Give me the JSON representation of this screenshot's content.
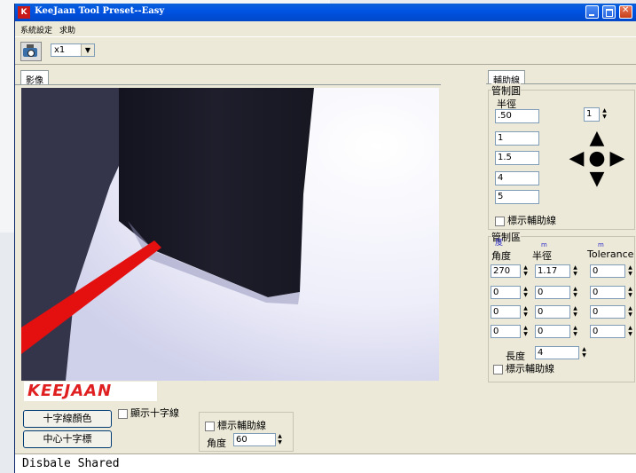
{
  "window": {
    "title": "KeeJaan Tool Preset--Easy",
    "app_icon_text": "K"
  },
  "menu": {
    "items": [
      "系統設定",
      "求助"
    ]
  },
  "toolbar": {
    "zoom_value": "x1"
  },
  "left_tab": {
    "label": "影像"
  },
  "logo": {
    "text": "KEEJAAN"
  },
  "bottom": {
    "crosshair_color_button": "十字線顏色",
    "center_crosshair_button": "中心十字標",
    "show_crosshair_label": "顯示十字線",
    "show_guides_label": "標示輔助線",
    "angle_label": "角度",
    "angle_value": "60"
  },
  "right_tab": {
    "label": "輔助線"
  },
  "control_circle": {
    "title": "管制圓",
    "radius_label": "半徑",
    "radii": [
      ".50",
      "1",
      "1.5",
      "4",
      "5"
    ],
    "spinner_value": "1",
    "show_guides_label": "標示輔助線"
  },
  "control_area": {
    "title": "管制區",
    "unit_angle": "度",
    "unit_radius": "m",
    "unit_tolerance": "m",
    "angle_header": "角度",
    "radius_header": "半徑",
    "tolerance_header": "Tolerance",
    "rows": [
      {
        "angle": "270",
        "radius": "1.17",
        "tolerance": "0"
      },
      {
        "angle": "0",
        "radius": "0",
        "tolerance": "0"
      },
      {
        "angle": "0",
        "radius": "0",
        "tolerance": "0"
      },
      {
        "angle": "0",
        "radius": "0",
        "tolerance": "0"
      }
    ],
    "length_label": "長度",
    "length_value": "4",
    "show_guides_label": "標示輔助線"
  },
  "status": {
    "text": "Disbale Shared"
  },
  "colors": {
    "titlebar": "#0054e3",
    "accent_red": "#e02020",
    "window_bg": "#ece9d8"
  }
}
